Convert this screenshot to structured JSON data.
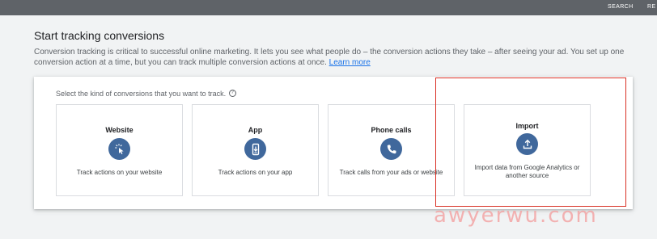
{
  "topbar": {
    "search_label": "SEARCH",
    "partial_label": "RE"
  },
  "page": {
    "title": "Start tracking conversions",
    "intro": "Conversion tracking is critical to successful online marketing. It lets you see what people do – the conversion actions they take – after seeing your ad. You set up one conversion action at a time, but you can track multiple conversion actions at once.",
    "learn_more": "Learn more"
  },
  "panel": {
    "prompt": "Select the kind of conversions that you want to track.",
    "help_icon": "help-circle-icon",
    "cards": [
      {
        "title": "Website",
        "icon": "cursor-click-icon",
        "description": "Track actions on your website"
      },
      {
        "title": "App",
        "icon": "phone-download-icon",
        "description": "Track actions on your app"
      },
      {
        "title": "Phone calls",
        "icon": "phone-icon",
        "description": "Track calls from your ads or website"
      },
      {
        "title": "Import",
        "icon": "upload-icon",
        "description": "Import data from Google Analytics or another source"
      }
    ]
  },
  "watermark": "awyerwu.com",
  "colors": {
    "accent": "#40689c",
    "link": "#1a73e8",
    "highlight": "#d93025",
    "topbar": "#5f6368"
  }
}
